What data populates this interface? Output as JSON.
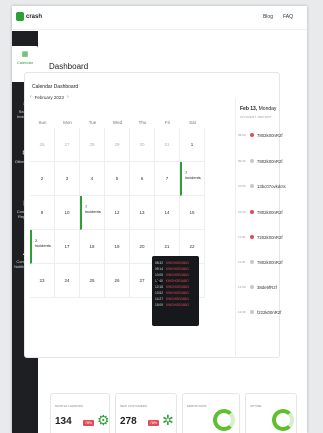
{
  "brand": {
    "logo_text": "crash"
  },
  "top_nav": {
    "blog": "Blog",
    "faq": "FAQ"
  },
  "sidebar": {
    "items": [
      {
        "label": "Calendar",
        "icon": "calendar-icon"
      },
      {
        "label": "Search Incidents",
        "icon": "search-icon"
      },
      {
        "label": "Other Tools",
        "icon": "gear-icon"
      },
      {
        "label": "Compare Reports",
        "icon": "bar-chart-icon"
      },
      {
        "label": "Configure Notifications",
        "icon": "bell-icon"
      }
    ]
  },
  "page": {
    "title": "Dashboard"
  },
  "calendar": {
    "title": "Calendar Dashboard",
    "month": "February 2023",
    "days_of_week": [
      "Sun",
      "Mon",
      "Tue",
      "Wed",
      "Thu",
      "Fri",
      "Sat"
    ],
    "weeks": [
      [
        "29",
        "30",
        "31",
        "1",
        "2",
        "3",
        "4"
      ],
      [
        "5",
        "6",
        "7",
        "8",
        "9",
        "10",
        "11"
      ],
      [
        "12",
        "13",
        "14",
        "15",
        "16",
        "17",
        "18"
      ],
      [
        "19",
        "20",
        "21",
        "22",
        "23",
        "24",
        "25"
      ],
      [
        "26",
        "27",
        "28",
        "1",
        "2",
        "3",
        "4"
      ]
    ],
    "weeks_display": [
      [
        "26",
        "27",
        "28",
        "29",
        "30",
        "31",
        "1"
      ],
      [
        "2",
        "3",
        "4",
        "5",
        "6",
        "7",
        "8"
      ],
      [
        "9",
        "10",
        "11",
        "12",
        "13",
        "14",
        "15"
      ],
      [
        "16",
        "17",
        "18",
        "19",
        "20",
        "21",
        "22"
      ],
      [
        "23",
        "24",
        "25",
        "26",
        "27",
        "28",
        "29"
      ]
    ],
    "events": [
      {
        "day": "8",
        "text": "7 incidents"
      },
      {
        "day": "11",
        "text": "7 incidents"
      },
      {
        "day": "16",
        "text": "2 incidents"
      }
    ],
    "tooltip_rows": [
      {
        "time": "08:32",
        "code": "KWGHGE0ABO"
      },
      {
        "time": "09:14",
        "code": "KWGHGE0ABO"
      },
      {
        "time": "10:05",
        "code": "KWGHGE0ABO"
      },
      {
        "time": "11:40",
        "code": "KWGHGE0ABO"
      },
      {
        "time": "12:18",
        "code": "KWGHGE0ABO"
      },
      {
        "time": "13:52",
        "code": "KWGHGE0ABO"
      },
      {
        "time": "14:27",
        "code": "KWGHGE0ABO"
      },
      {
        "time": "15:09",
        "code": "KWGHGE0ABO"
      }
    ]
  },
  "incident_panel": {
    "date": "Feb 13,",
    "weekday": "Monday",
    "subtitle": "INCIDENT REPORT",
    "items": [
      {
        "time": "09:00",
        "code": "7802k00nR2f",
        "status": "red"
      },
      {
        "time": "09:30",
        "code": "7802k00nR2f",
        "status": "grey"
      },
      {
        "time": "10:00",
        "code": "13bc07ovkdcts",
        "status": "grey"
      },
      {
        "time": "10:30",
        "code": "7802k00nR2f",
        "status": "red"
      },
      {
        "time": "11:00",
        "code": "7202k00nR2f",
        "status": "red"
      },
      {
        "time": "11:30",
        "code": "7802k00nR2f",
        "status": "grey"
      },
      {
        "time": "12:00",
        "code": "38de9fR2f",
        "status": "grey"
      },
      {
        "time": "12:30",
        "code": "f222k00nR2f",
        "status": "grey"
      }
    ]
  },
  "stats": [
    {
      "label": "MONTHLY ERRORS",
      "value": "134",
      "pct": "78%"
    },
    {
      "label": "NEW CUSTOMERS",
      "value": "278",
      "pct": "78%"
    },
    {
      "label": "ERROR RATE",
      "value": "",
      "pct": ""
    },
    {
      "label": "UPTIME",
      "value": "",
      "pct": ""
    }
  ],
  "colors": {
    "accent": "#2e9e38",
    "alert": "#e24b5a",
    "sidebar_bg": "#1d1f23"
  }
}
